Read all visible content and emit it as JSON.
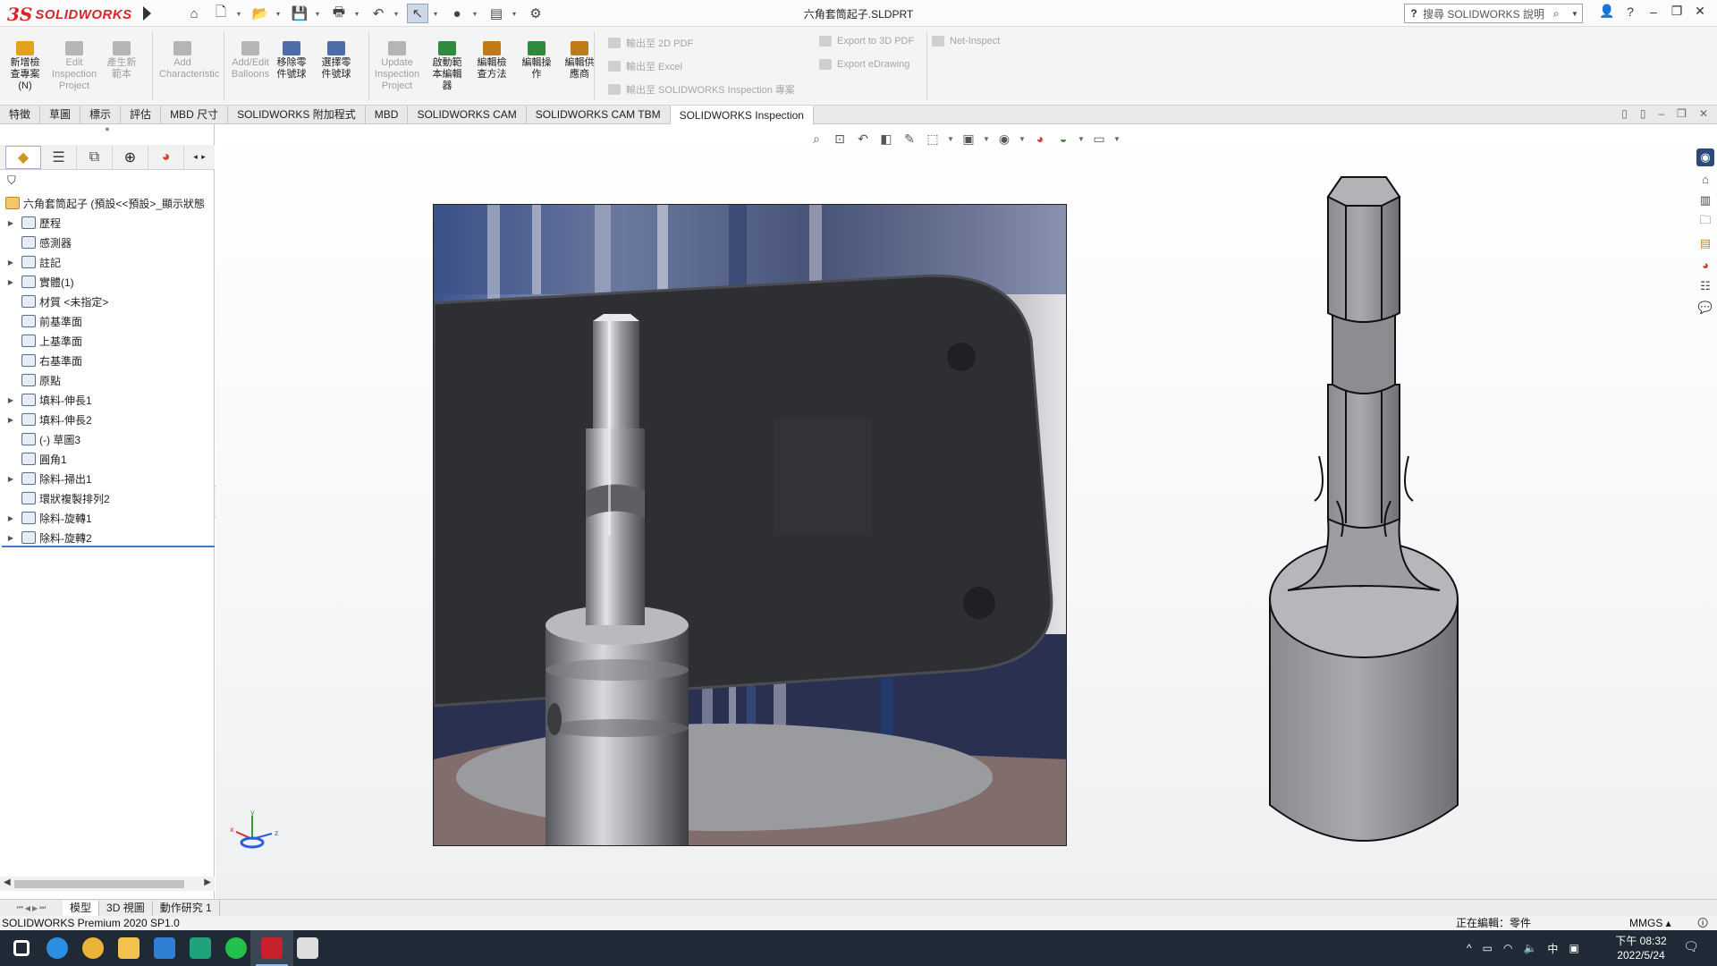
{
  "app": {
    "logo_ds": "3S",
    "logo_text": "SOLIDWORKS",
    "document_title": "六角套筒起子.SLDPRT",
    "search_placeholder": "搜尋 SOLIDWORKS 說明",
    "search_help_glyph": "?"
  },
  "quick_access": [
    {
      "name": "home-icon",
      "glyph": "⌂"
    },
    {
      "name": "new-document-icon",
      "glyph": "🗋"
    },
    {
      "name": "open-icon",
      "glyph": "📂"
    },
    {
      "name": "save-icon",
      "glyph": "💾"
    },
    {
      "name": "print-icon",
      "glyph": "🖶"
    },
    {
      "name": "undo-icon",
      "glyph": "↶"
    },
    {
      "name": "select-icon",
      "glyph": "↖"
    },
    {
      "name": "traffic-light-icon",
      "glyph": "●"
    },
    {
      "name": "file-properties-icon",
      "glyph": "▤"
    },
    {
      "name": "options-gear-icon",
      "glyph": "⚙"
    }
  ],
  "window_controls": {
    "user": "👤",
    "help": "?",
    "minimize": "–",
    "restore": "❐",
    "close": "✕"
  },
  "command_manager": {
    "buttons": [
      {
        "label": "新增檢\n查專案\n(N)",
        "enabled": true
      },
      {
        "label": "Edit\nInspection\nProject",
        "enabled": false
      },
      {
        "label": "產生新\n範本",
        "enabled": false
      },
      {
        "label": "Add\nCharacteristic",
        "enabled": false
      },
      {
        "label": "Add/Edit\nBalloons",
        "enabled": false
      },
      {
        "label": "移除零\n件號球",
        "enabled": true
      },
      {
        "label": "選擇零\n件號球",
        "enabled": true
      },
      {
        "label": "Update\nInspection\nProject",
        "enabled": false
      },
      {
        "label": "啟動範\n本編輯\n器",
        "enabled": true
      },
      {
        "label": "編輯檢\n查方法",
        "enabled": true
      },
      {
        "label": "編輯操\n作",
        "enabled": true
      },
      {
        "label": "編輯供\n應商",
        "enabled": true
      }
    ],
    "export_rows": [
      {
        "label": "輸出至 2D PDF"
      },
      {
        "label": "輸出至 Excel"
      },
      {
        "label": "輸出至 SOLIDWORKS Inspection 專案"
      }
    ],
    "export_rows_2": [
      {
        "label": "Export to 3D PDF"
      },
      {
        "label": "Export eDrawing"
      }
    ],
    "net_inspect": "Net-Inspect"
  },
  "tabs": [
    "特徵",
    "草圖",
    "標示",
    "評估",
    "MBD 尺寸",
    "SOLIDWORKS 附加程式",
    "MBD",
    "SOLIDWORKS CAM",
    "SOLIDWORKS CAM TBM",
    "SOLIDWORKS Inspection"
  ],
  "active_tab": "SOLIDWORKS Inspection",
  "feature_tree": {
    "root": "六角套筒起子 (預設<<預設>_顯示狀態",
    "nodes": [
      {
        "label": "歷程",
        "expandable": true
      },
      {
        "label": "感測器",
        "expandable": false
      },
      {
        "label": "註記",
        "expandable": true
      },
      {
        "label": "實體(1)",
        "expandable": true
      },
      {
        "label": "材質 <未指定>",
        "expandable": false
      },
      {
        "label": "前基準面",
        "expandable": false
      },
      {
        "label": "上基準面",
        "expandable": false
      },
      {
        "label": "右基準面",
        "expandable": false
      },
      {
        "label": "原點",
        "expandable": false
      },
      {
        "label": "填料-伸長1",
        "expandable": true
      },
      {
        "label": "填料-伸長2",
        "expandable": true
      },
      {
        "label": "(-) 草圖3",
        "expandable": false
      },
      {
        "label": "圓角1",
        "expandable": false
      },
      {
        "label": "除料-掃出1",
        "expandable": true
      },
      {
        "label": "環狀複製排列2",
        "expandable": false
      },
      {
        "label": "除料-旋轉1",
        "expandable": true
      },
      {
        "label": "除料-旋轉2",
        "expandable": true
      }
    ]
  },
  "bottom_tabs": [
    "模型",
    "3D 視圖",
    "動作研究 1"
  ],
  "active_bottom_tab": "模型",
  "status": {
    "product": "SOLIDWORKS Premium 2020 SP1.0",
    "editing": "正在編輯：零件",
    "units": "MMGS ▴"
  },
  "taskbar": {
    "apps": [
      {
        "name": "windows-start-icon",
        "color": "#ffffff"
      },
      {
        "name": "edge-icon",
        "color": "#2b8ee0"
      },
      {
        "name": "chrome-icon",
        "color": "#e9b437"
      },
      {
        "name": "file-explorer-icon",
        "color": "#f2c14e"
      },
      {
        "name": "outlook-icon",
        "color": "#2f7fd4"
      },
      {
        "name": "security-app-icon",
        "color": "#1fa37a"
      },
      {
        "name": "line-icon",
        "color": "#21c14b"
      },
      {
        "name": "solidworks-taskbar-icon",
        "color": "#c8202d"
      },
      {
        "name": "shield-icon",
        "color": "#dddddd"
      }
    ],
    "ime": "中",
    "time": "下午 08:32",
    "date": "2022/5/24"
  }
}
